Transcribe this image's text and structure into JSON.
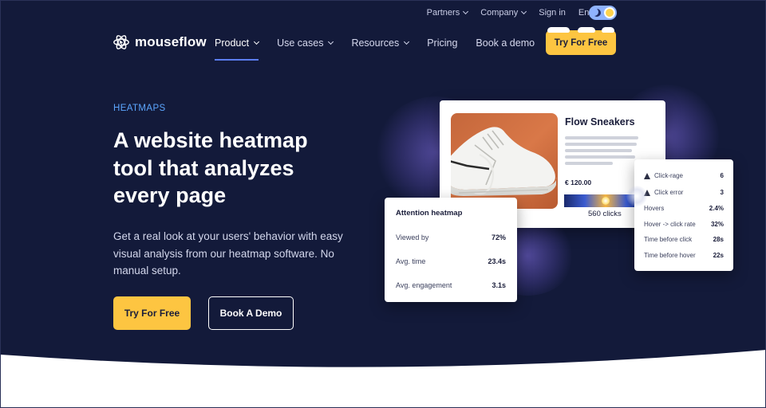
{
  "colors": {
    "background": "#131a3a",
    "accent": "#fdc541",
    "eyebrow": "#5ca6ff",
    "nav_underline": "#5b7df0"
  },
  "topbar": {
    "items": [
      {
        "label": "Partners",
        "has_dropdown": true
      },
      {
        "label": "Company",
        "has_dropdown": true
      },
      {
        "label": "Sign in",
        "has_dropdown": false
      },
      {
        "label": "English",
        "has_dropdown": true
      }
    ],
    "theme_toggle": {
      "icons": [
        "moon-icon",
        "sun-icon"
      ]
    }
  },
  "logo": {
    "text": "mouseflow",
    "icon": "mouseflow-logo-icon"
  },
  "nav": {
    "items": [
      {
        "label": "Product",
        "has_dropdown": true,
        "active": true
      },
      {
        "label": "Use cases",
        "has_dropdown": true
      },
      {
        "label": "Resources",
        "has_dropdown": true
      },
      {
        "label": "Pricing",
        "has_dropdown": false
      },
      {
        "label": "Book a demo",
        "has_dropdown": false
      }
    ],
    "cta_label": "Try For Free"
  },
  "hero": {
    "eyebrow": "HEATMAPS",
    "headline": "A website heatmap tool that analyzes every page",
    "subtext": "Get a real look at your users' behavior with easy visual analysis from our heatmap software. No manual setup.",
    "primary_button": "Try For Free",
    "secondary_button": "Book A Demo"
  },
  "illustration": {
    "product_card": {
      "name": "Flow Sneakers",
      "price": "€ 120.00",
      "clicks": "560 clicks"
    },
    "attention_card": {
      "title": "Attention heatmap",
      "rows": [
        {
          "label": "Viewed by",
          "value": "72%"
        },
        {
          "label": "Avg. time",
          "value": "23.4s"
        },
        {
          "label": "Avg. engagement",
          "value": "3.1s"
        }
      ]
    },
    "metrics_card": {
      "rows": [
        {
          "label": "Click-rage",
          "value": "6",
          "icon": "warning-icon"
        },
        {
          "label": "Click error",
          "value": "3",
          "icon": "warning-icon"
        },
        {
          "label": "Hovers",
          "value": "2.4%"
        },
        {
          "label": "Hover -> click rate",
          "value": "32%"
        },
        {
          "label": "Time before click",
          "value": "28s"
        },
        {
          "label": "Time before hover",
          "value": "22s"
        }
      ]
    }
  }
}
